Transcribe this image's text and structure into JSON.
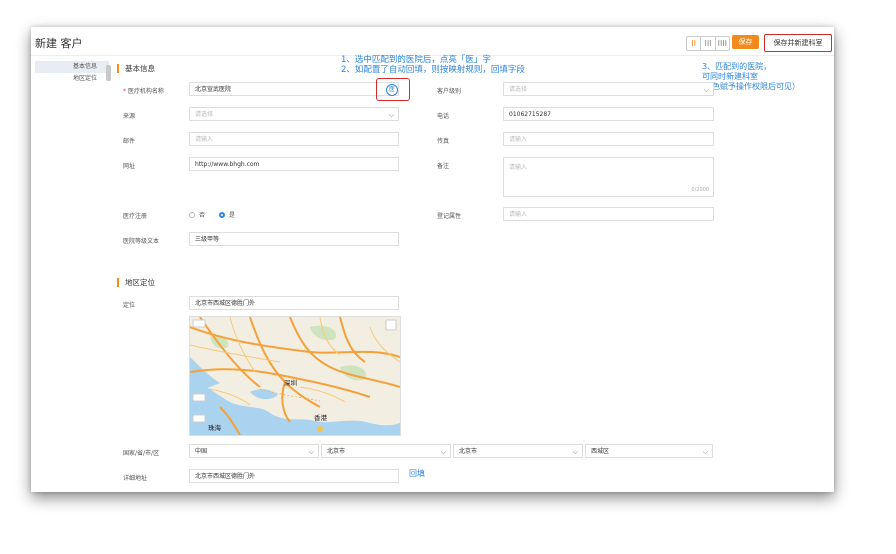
{
  "header": {
    "title": "新建 客户",
    "view_options": [
      "II",
      "III",
      "IIII"
    ],
    "save_label": "保存",
    "save_new_label": "保存并新建科室"
  },
  "sidenav": {
    "items": [
      {
        "label": "基本信息",
        "active": true
      },
      {
        "label": "地区定位",
        "active": false
      }
    ]
  },
  "sections": {
    "basic": "基本信息",
    "location": "地区定位"
  },
  "annotations": {
    "note1_line1": "1、选中匹配到的医院后，点亮「医」字",
    "note1_line2": "2、如配置了自动回填，则按映射规则，回填字段",
    "note3_line1": "3、匹配到的医院，",
    "note3_line2": "可同时新建科室",
    "note3_line3": "（角色赋予操作权限后可见）"
  },
  "basic": {
    "org_name": {
      "label": "医疗机构名称",
      "required_mark": "*",
      "value": "北京宣武医院",
      "icon_text": "医"
    },
    "source": {
      "label": "来源",
      "placeholder": "请选择"
    },
    "email": {
      "label": "邮件",
      "placeholder": "请输入"
    },
    "url": {
      "label": "网址",
      "value": "http://www.bhgh.com"
    },
    "medical_reg": {
      "label": "医疗注册",
      "opt_no": "否",
      "opt_yes": "是"
    },
    "hospital_level_text": {
      "label": "医院等级文本",
      "value": "三级甲等"
    },
    "customer_level": {
      "label": "客户级别",
      "placeholder": "请选择"
    },
    "phone": {
      "label": "电话",
      "value": "01062715287"
    },
    "fax": {
      "label": "传真",
      "placeholder": "请输入"
    },
    "remarks": {
      "label": "备注",
      "placeholder": "请输入",
      "counter": "0/2000"
    },
    "register_attr": {
      "label": "登记属性",
      "placeholder": "请输入"
    }
  },
  "location": {
    "position": {
      "label": "定位",
      "value": "北京市西城区德胜门外"
    },
    "map_labels": {
      "city1": "深圳",
      "city2": "珠海",
      "city3": "香港"
    },
    "region": {
      "label": "国家/省/市/区",
      "country": "中国",
      "province": "北京市",
      "city": "北京市",
      "district": "西城区"
    },
    "detail": {
      "label": "详细地址",
      "value": "北京市西城区德胜门外"
    },
    "backfill_label": "回填"
  },
  "colors": {
    "accent": "#f28a1e",
    "highlight": "#d42a2a",
    "link": "#2e86de"
  }
}
